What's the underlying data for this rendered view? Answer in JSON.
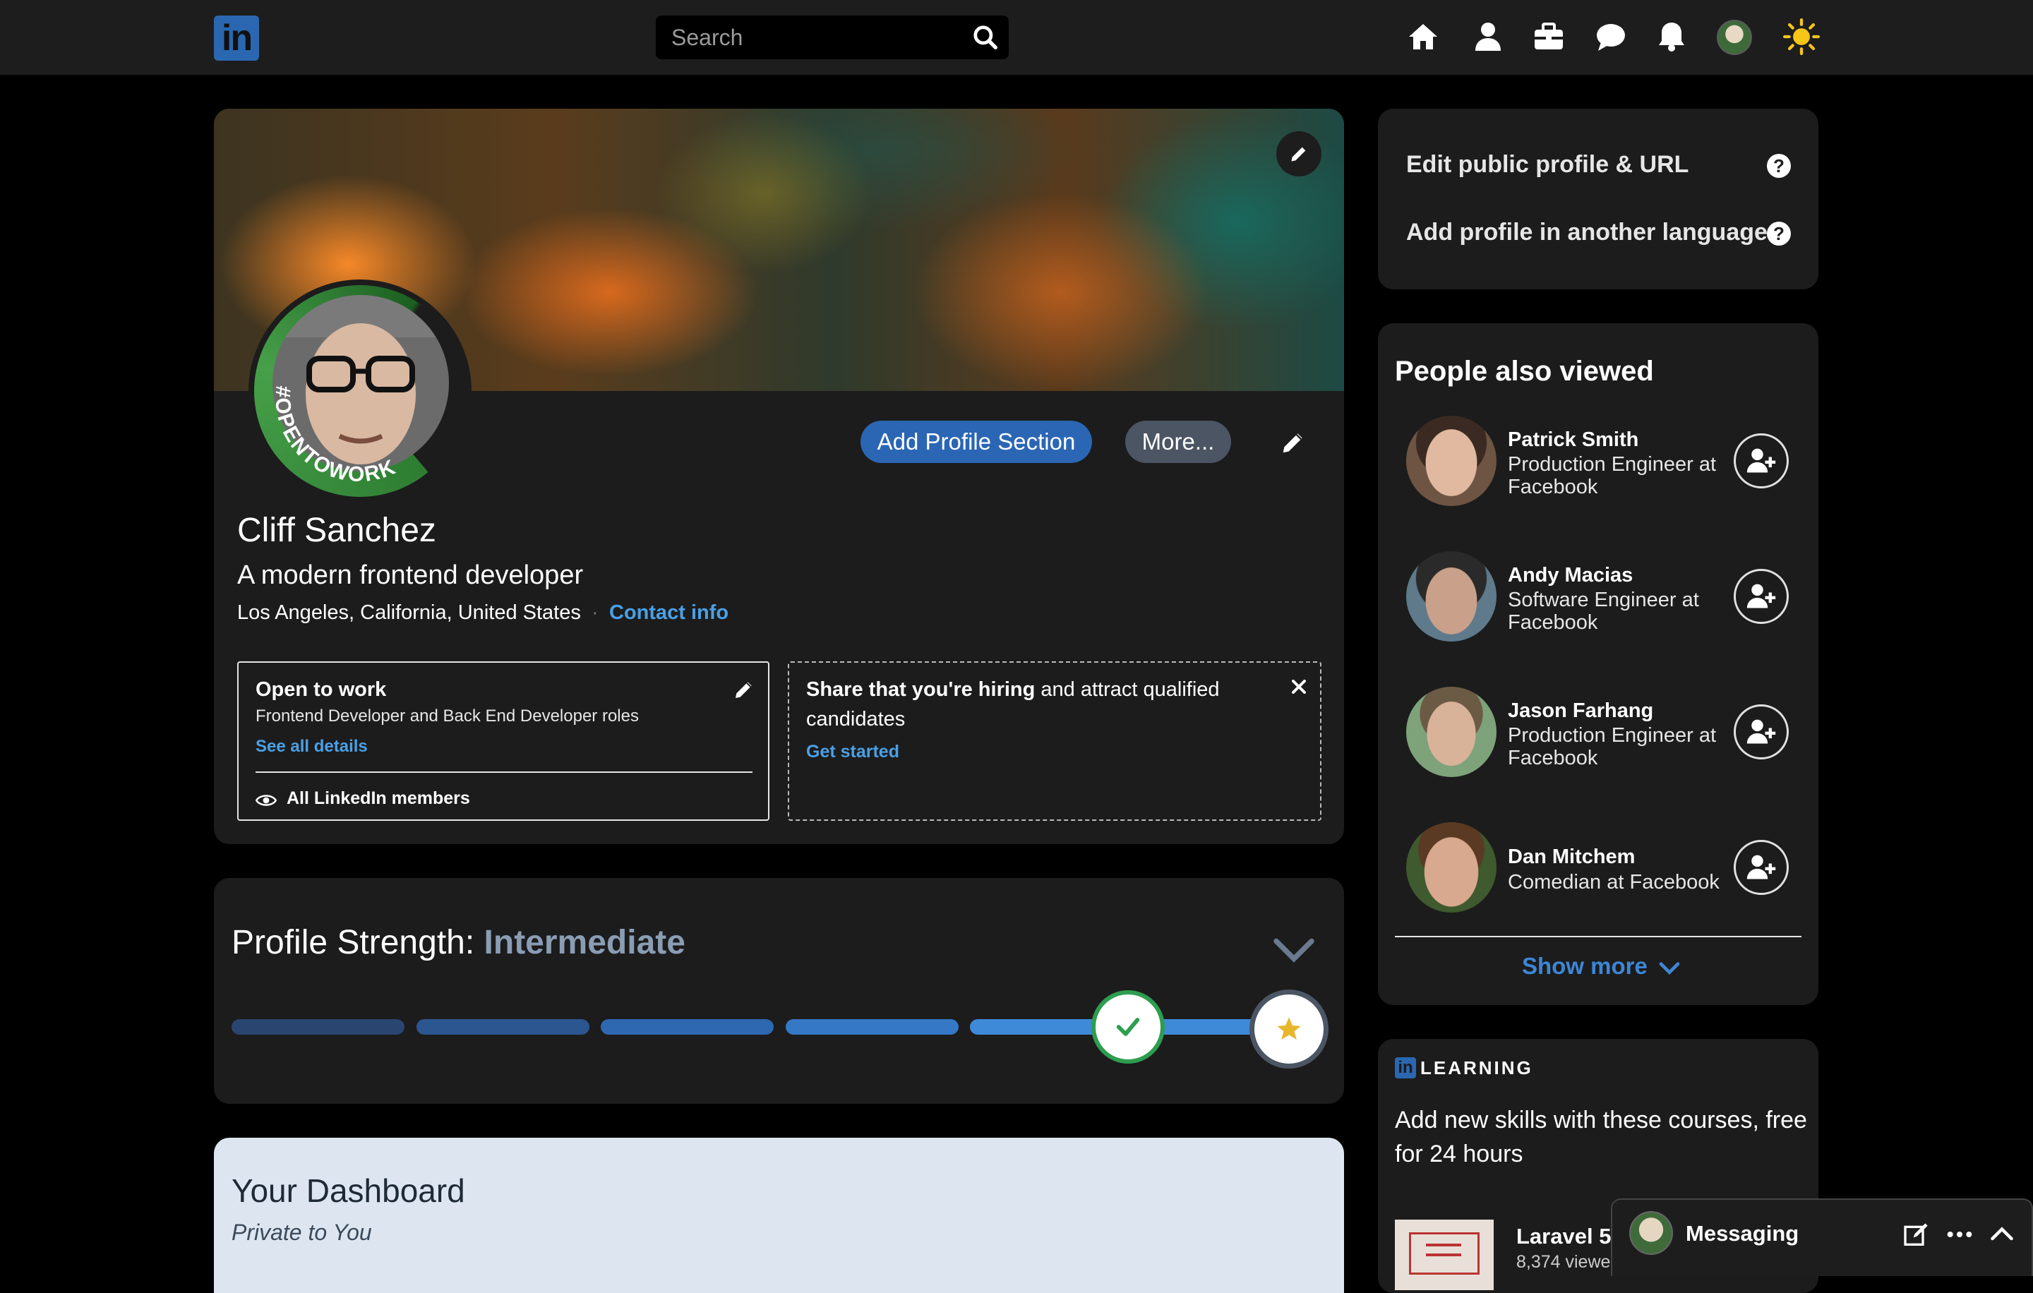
{
  "header": {
    "logo_text": "in",
    "search_placeholder": "Search",
    "nav_icons": [
      "home-icon",
      "profile-icon",
      "jobs-briefcase-icon",
      "messaging-icon",
      "notifications-bell-icon",
      "avatar",
      "theme-toggle-sun-icon"
    ]
  },
  "profile": {
    "name": "Cliff Sanchez",
    "headline": "A modern frontend developer",
    "location": "Los Angeles, California, United States",
    "separator": "·",
    "contact_info": "Contact info",
    "open_to_work_badge": "#OPENTOWORK",
    "add_section_label": "Add Profile Section",
    "more_label": "More...",
    "open_to_work": {
      "title": "Open to work",
      "roles": "Frontend Developer and Back End Developer roles",
      "details_link": "See all details",
      "visibility": "All LinkedIn members"
    },
    "hiring": {
      "title_bold": "Share that you're hiring",
      "title_rest": " and attract qualified",
      "title_line2": "candidates",
      "cta": "Get started"
    }
  },
  "strength": {
    "label": "Profile Strength:",
    "level": "Intermediate",
    "progress_fraction": 0.8
  },
  "dashboard": {
    "title": "Your Dashboard",
    "subtitle": "Private to You"
  },
  "sidebar": {
    "links": [
      {
        "label": "Edit public profile & URL"
      },
      {
        "label": "Add profile in another language"
      }
    ],
    "people_title": "People also viewed",
    "people": [
      {
        "name": "Patrick Smith",
        "role": "Production Engineer at Facebook"
      },
      {
        "name": "Andy Macias",
        "role": "Software Engineer at Facebook"
      },
      {
        "name": "Jason Farhang",
        "role": "Production Engineer at Facebook"
      },
      {
        "name": "Dan Mitchem",
        "role": "Comedian at Facebook"
      }
    ],
    "show_more": "Show more",
    "learning": {
      "label": "LEARNING",
      "blurb_line1": "Add new skills with these courses, free",
      "blurb_line2": "for 24 hours",
      "course_title": "Laravel 5",
      "course_meta": "8,374 viewe"
    }
  },
  "messaging": {
    "label": "Messaging"
  },
  "colors": {
    "accent": "#2a66b4",
    "link": "#4aa0e6",
    "success": "#2e9d4f",
    "star": "#e8b62c"
  }
}
